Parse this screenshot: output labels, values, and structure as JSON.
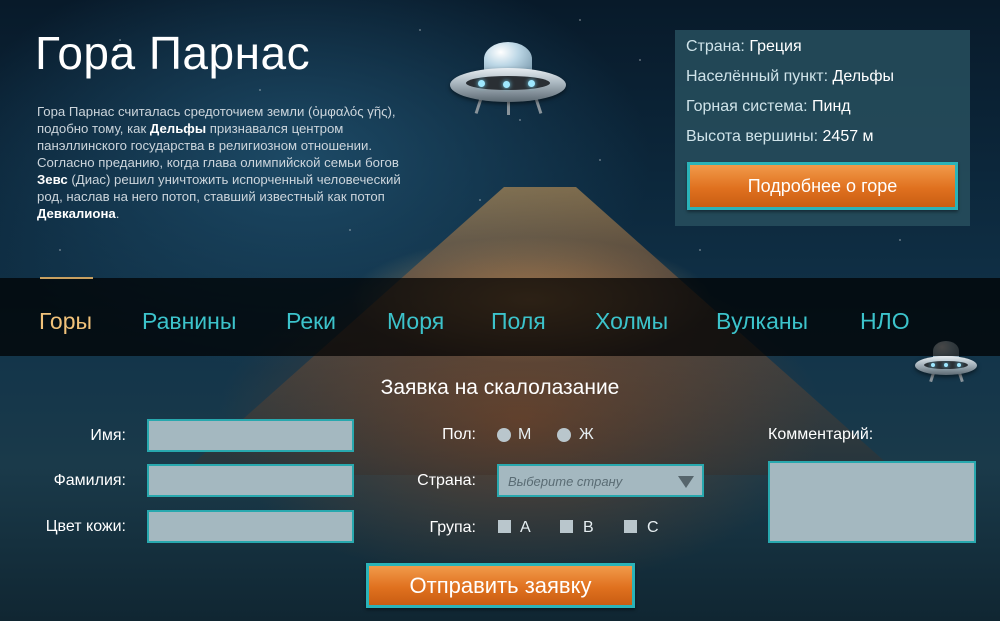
{
  "header": {
    "title": "Гора Парнас",
    "intro": [
      {
        "text": "Гора Парнас считалась средоточием земли (ὀμφαλός γῆς), подобно тому, как ",
        "bold": false
      },
      {
        "text": "Дельфы",
        "bold": true
      },
      {
        "text": " признавался центром панэллинского государства в религиозном отношении. Согласно преданию, когда глава олимпийской семьи богов ",
        "bold": false
      },
      {
        "text": "Зевс",
        "bold": true
      },
      {
        "text": " (Диас) решил уничтожить испорченный человеческий род, наслав на него потоп, ставший известный как потоп ",
        "bold": false
      },
      {
        "text": "Девкалиона",
        "bold": true
      },
      {
        "text": ".",
        "bold": false
      }
    ]
  },
  "info": {
    "country_label": "Страна:",
    "country_value": "Греция",
    "locality_label": "Населённый пункт:",
    "locality_value": "Дельфы",
    "range_label": "Горная система:",
    "range_value": "Пинд",
    "height_label": "Высота вершины:",
    "height_value": "2457 м",
    "more_button": "Подробнее о горе"
  },
  "nav": {
    "items": [
      "Горы",
      "Равнины",
      "Реки",
      "Моря",
      "Поля",
      "Холмы",
      "Вулканы",
      "НЛО"
    ],
    "active_index": 0
  },
  "form": {
    "title": "Заявка на скалолазание",
    "name_label": "Имя:",
    "surname_label": "Фамилия:",
    "skin_label": "Цвет кожи:",
    "gender_label": "Пол:",
    "gender_options": [
      "М",
      "Ж"
    ],
    "country_label": "Страна:",
    "country_placeholder": "Выберите страну",
    "group_label": "Група:",
    "group_options": [
      "A",
      "B",
      "C"
    ],
    "comment_label": "Комментарий:",
    "submit": "Отправить заявку"
  },
  "colors": {
    "accent": "#2ab3b8",
    "button_orange": "#e0711f",
    "nav_text": "#3cc3cb",
    "nav_active": "#f1c27a"
  },
  "icons": [
    "ufo-icon",
    "ufo-small-icon",
    "dropdown-caret-icon"
  ]
}
